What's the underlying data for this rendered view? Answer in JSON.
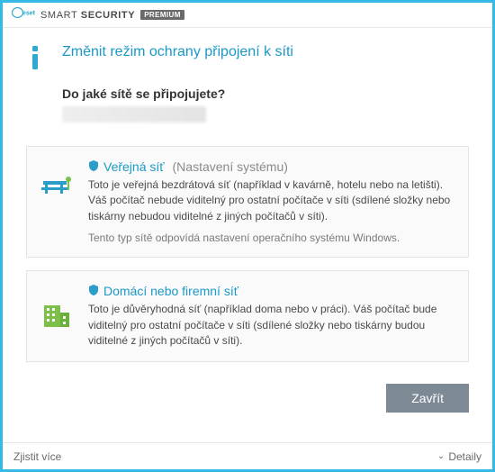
{
  "header": {
    "brand_prefix": "SMART",
    "brand_suffix": "SECURITY",
    "premium": "PREMIUM"
  },
  "title": "Změnit režim ochrany připojení k síti",
  "question": "Do jaké sítě se připojujete?",
  "options": {
    "public": {
      "title": "Veřejná síť",
      "subtitle": "(Nastavení systému)",
      "desc": "Toto je veřejná bezdrátová síť (například v kavárně, hotelu nebo na letišti). Váš počítač nebude viditelný pro ostatní počítače v síti (sdílené složky nebo tiskárny nebudou viditelné z jiných počítačů v síti).",
      "note": "Tento typ sítě odpovídá nastavení operačního systému Windows."
    },
    "home": {
      "title": "Domácí nebo firemní síť",
      "desc": "Toto je důvěryhodná síť (například doma nebo v práci). Váš počítač bude viditelný pro ostatní počítače v síti (sdílené složky nebo tiskárny budou viditelné z jiných počítačů v síti)."
    }
  },
  "buttons": {
    "close": "Zavřít"
  },
  "footer": {
    "learn_more": "Zjistit více",
    "details": "Detaily"
  }
}
